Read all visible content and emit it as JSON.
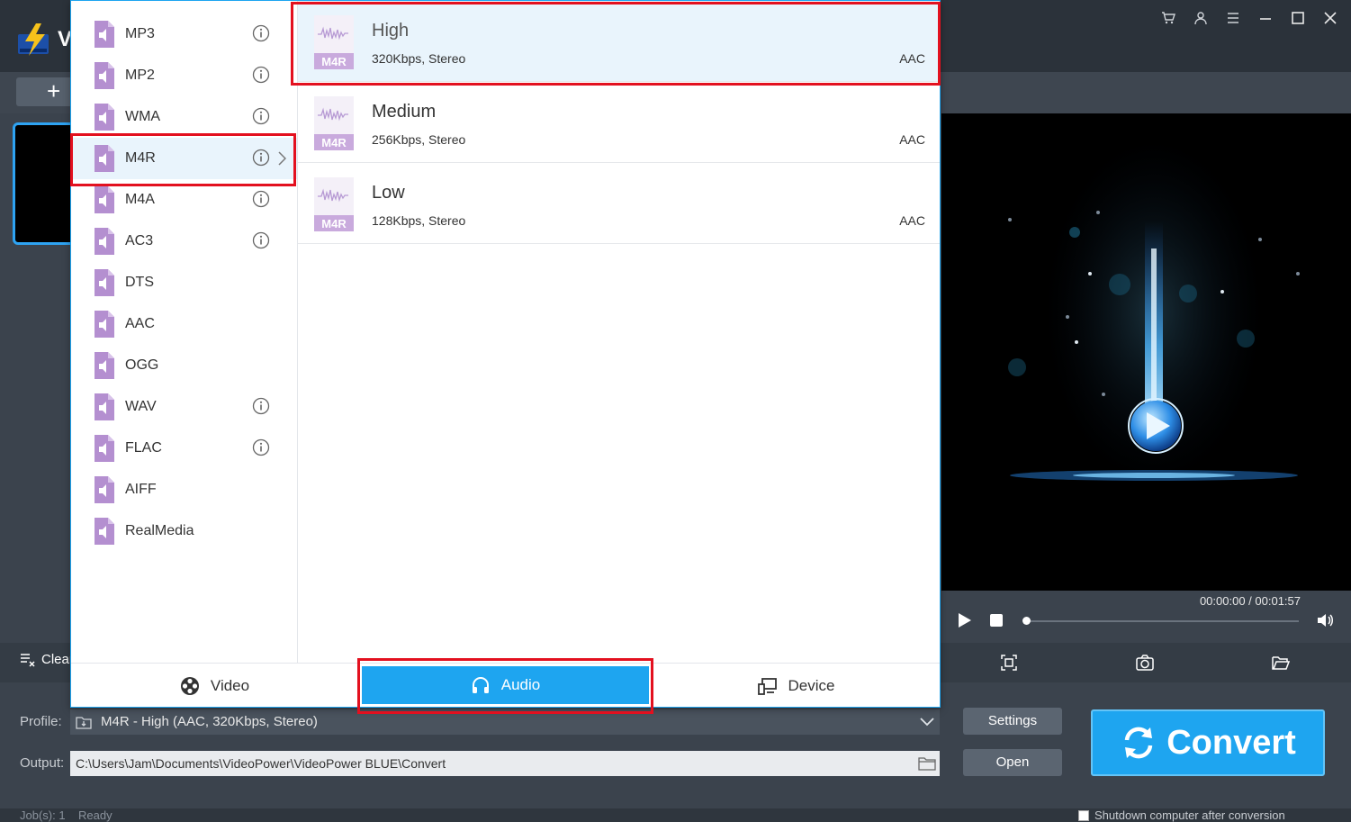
{
  "app": {
    "name_fragment": "V",
    "add_symbol": "+"
  },
  "format_list": {
    "items": [
      {
        "label": "MP3",
        "info": true
      },
      {
        "label": "MP2",
        "info": true
      },
      {
        "label": "WMA",
        "info": true
      },
      {
        "label": "M4R",
        "info": true,
        "selected": true
      },
      {
        "label": "M4A",
        "info": true
      },
      {
        "label": "AC3",
        "info": true
      },
      {
        "label": "DTS",
        "info": false
      },
      {
        "label": "AAC",
        "info": false
      },
      {
        "label": "OGG",
        "info": false
      },
      {
        "label": "WAV",
        "info": true
      },
      {
        "label": "FLAC",
        "info": true
      },
      {
        "label": "AIFF",
        "info": false
      },
      {
        "label": "RealMedia",
        "info": false
      }
    ]
  },
  "quality_list": {
    "badge": "M4R",
    "items": [
      {
        "name": "High",
        "detail": "320Kbps, Stereo",
        "codec": "AAC",
        "selected": true
      },
      {
        "name": "Medium",
        "detail": "256Kbps, Stereo",
        "codec": "AAC"
      },
      {
        "name": "Low",
        "detail": "128Kbps, Stereo",
        "codec": "AAC"
      }
    ]
  },
  "tabs": {
    "video": "Video",
    "audio": "Audio",
    "device": "Device",
    "active": "audio"
  },
  "player": {
    "time": "00:00:00 / 00:01:57"
  },
  "actions": {
    "clear": "Clear"
  },
  "profile": {
    "label": "Profile:",
    "value": "M4R - High (AAC, 320Kbps, Stereo)"
  },
  "output": {
    "label": "Output:",
    "value": "C:\\Users\\Jam\\Documents\\VideoPower\\VideoPower BLUE\\Convert"
  },
  "buttons": {
    "settings": "Settings",
    "open": "Open",
    "convert": "Convert"
  },
  "status": {
    "jobs": "Job(s): 1",
    "state": "Ready",
    "shutdown": "Shutdown computer after conversion"
  },
  "colors": {
    "accent": "#1ea5f0",
    "highlight": "#e3101f",
    "format_icon": "#b48fd0"
  }
}
